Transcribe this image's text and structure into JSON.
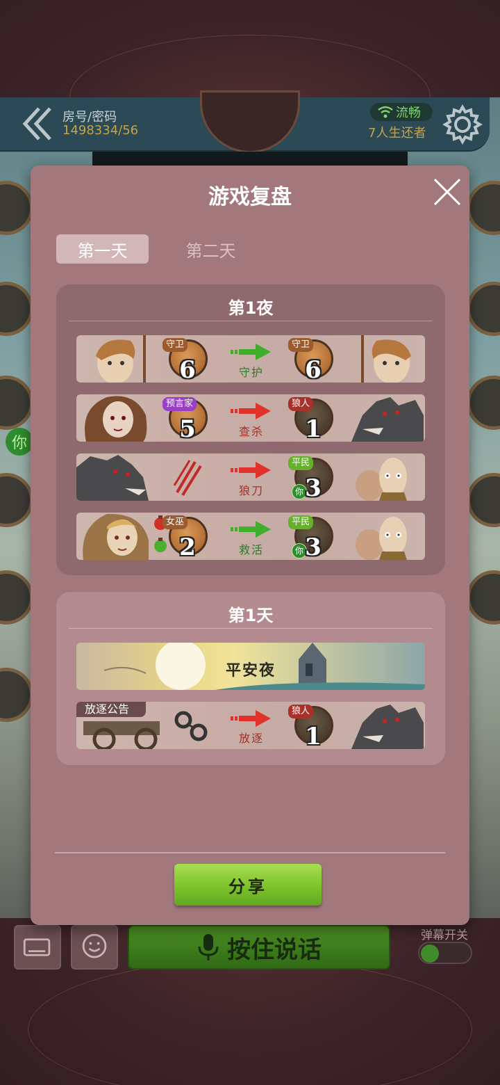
{
  "header": {
    "room_label": "房号/密码",
    "room_code": "1498334/56",
    "network_status": "流畅",
    "survivors": "7人生还者"
  },
  "side": {
    "self_badge": "你"
  },
  "bottom_bar": {
    "talk_label": "按住说话",
    "danmaku_label": "弹幕开关"
  },
  "modal": {
    "title": "游戏复盘",
    "tabs": [
      {
        "label": "第一天",
        "active": true
      },
      {
        "label": "第二天",
        "active": false
      }
    ],
    "night": {
      "title": "第1夜",
      "rows": [
        {
          "actor_role": "守卫",
          "actor_num": "6",
          "action": "守护",
          "action_color": "green",
          "target_role": "守卫",
          "target_num": "6",
          "target_is_you": false
        },
        {
          "actor_role": "预言家",
          "actor_num": "5",
          "action": "查杀",
          "action_color": "red",
          "target_role": "狼人",
          "target_num": "1",
          "target_is_you": false
        },
        {
          "actor_role": "",
          "actor_num": "",
          "action": "狼刀",
          "action_color": "red",
          "target_role": "平民",
          "target_num": "3",
          "target_is_you": true
        },
        {
          "actor_role": "女巫",
          "actor_num": "2",
          "action": "救活",
          "action_color": "green",
          "target_role": "平民",
          "target_num": "3",
          "target_is_you": true
        }
      ],
      "you_label": "你"
    },
    "day": {
      "title": "第1天",
      "banner": "平安夜",
      "exile_tag": "放逐公告",
      "exile_action": "放逐",
      "exile_target_role": "狼人",
      "exile_target_num": "1"
    },
    "share_label": "分享"
  },
  "colors": {
    "modal_bg": "#a3787d",
    "green_arrow": "#3fae2a",
    "red_arrow": "#e0322a",
    "share_green": "#7cc32c"
  }
}
